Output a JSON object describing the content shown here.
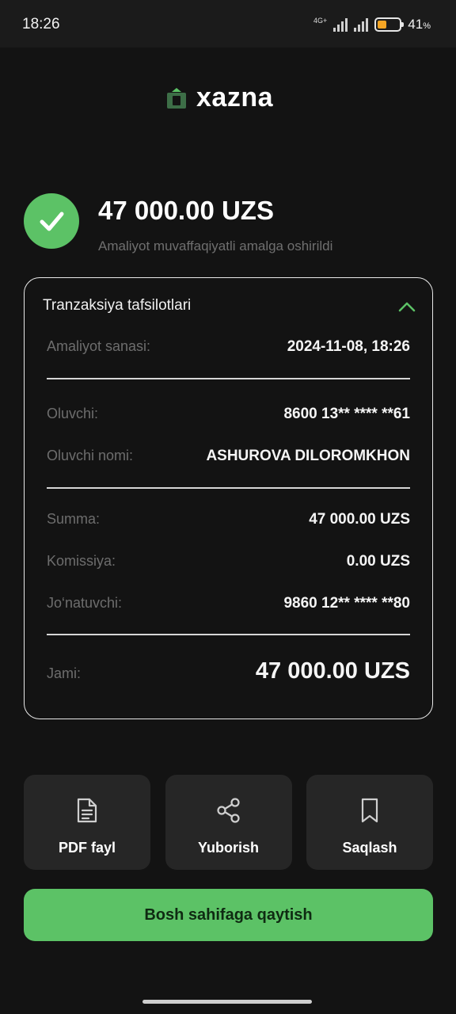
{
  "status_bar": {
    "time": "18:26",
    "network": "4G+",
    "battery_percent": "41",
    "battery_unit": "%"
  },
  "brand": {
    "name": "xazna",
    "accent": "#5cc266"
  },
  "result": {
    "amount": "47 000.00 UZS",
    "message": "Amaliyot muvaffaqiyatli amalga oshirildi"
  },
  "details": {
    "title": "Tranzaksiya tafsilotlari",
    "rows": [
      {
        "label": "Amaliyot sanasi:",
        "value": "2024-11-08, 18:26"
      },
      {
        "label": "Oluvchi:",
        "value": "8600 13** **** **61"
      },
      {
        "label": "Oluvchi nomi:",
        "value": "ASHUROVA DILOROMKHON"
      },
      {
        "label": "Summa:",
        "value": "47 000.00 UZS"
      },
      {
        "label": "Komissiya:",
        "value": "0.00 UZS"
      },
      {
        "label": "Jo‘natuvchi:",
        "value": "9860 12** **** **80"
      },
      {
        "label": "Jami:",
        "value": "47 000.00 UZS"
      }
    ]
  },
  "actions": {
    "pdf_label": "PDF fayl",
    "share_label": "Yuborish",
    "save_label": "Saqlash"
  },
  "home_button_label": "Bosh sahifaga qaytish"
}
